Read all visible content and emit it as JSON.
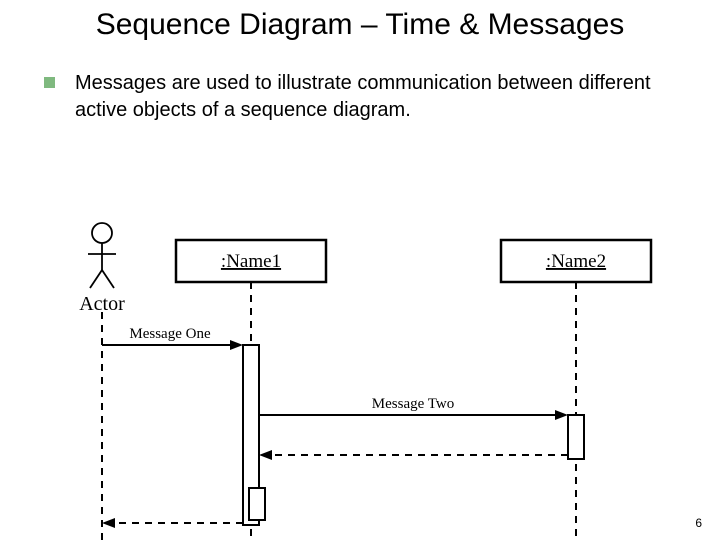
{
  "title": "Sequence Diagram – Time & Messages",
  "bullet": "Messages are used to illustrate communication between different active objects of a sequence diagram.",
  "actor_label": "Actor",
  "object1": ":Name1",
  "object2": ":Name2",
  "msg1": "Message One",
  "msg2": "Message Two",
  "slide_number": "6"
}
